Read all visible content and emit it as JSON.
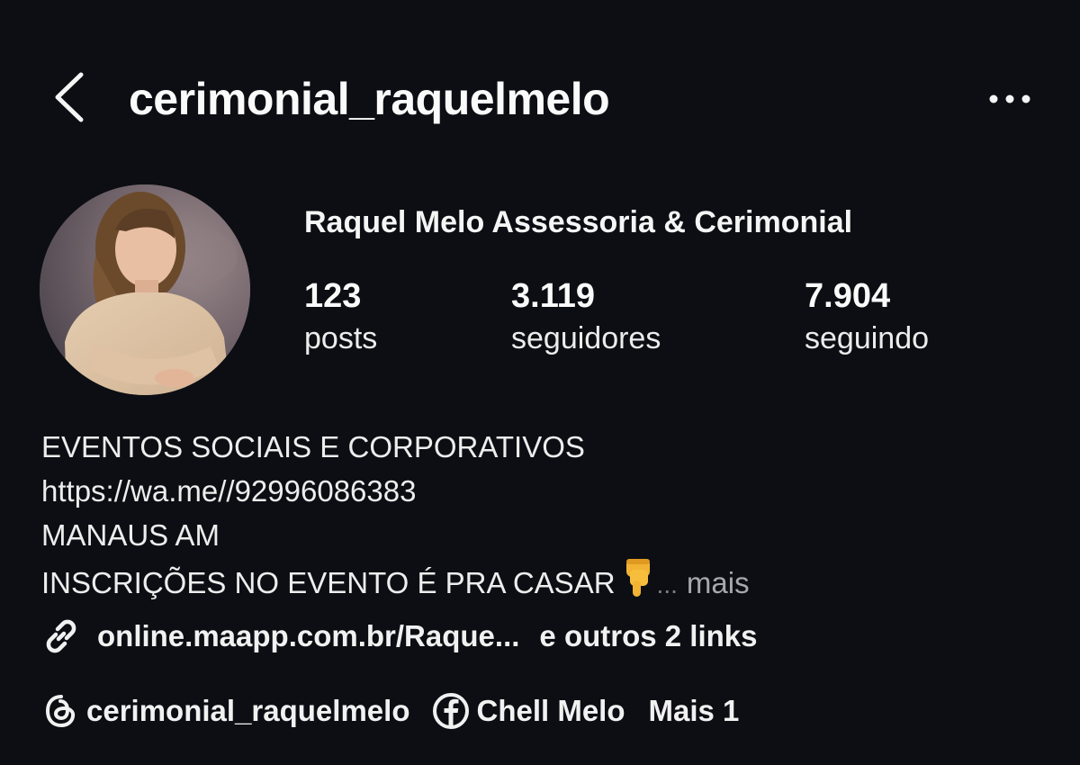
{
  "header": {
    "username": "cerimonial_raquelmelo"
  },
  "profile": {
    "display_name": "Raquel Melo Assessoria & Cerimonial",
    "stats": {
      "posts": {
        "value": "123",
        "label": "posts"
      },
      "followers": {
        "value": "3.119",
        "label": "seguidores"
      },
      "following": {
        "value": "7.904",
        "label": "seguindo"
      }
    },
    "bio": {
      "line1": "EVENTOS SOCIAIS E CORPORATIVOS",
      "line2": "https://wa.me//92996086383",
      "line3": "MANAUS AM",
      "line4": "INSCRIÇÕES NO EVENTO É PRA CASAR",
      "ellipsis": "...",
      "more": "mais"
    },
    "links": {
      "primary": "online.maapp.com.br/Raque...",
      "others": "e outros 2 links"
    },
    "social": {
      "threads": "cerimonial_raquelmelo",
      "facebook": "Chell Melo",
      "more": "Mais 1"
    }
  },
  "icons": {
    "back": "chevron-left-icon",
    "more": "more-horizontal-icon",
    "link": "link-icon",
    "threads": "threads-icon",
    "facebook": "facebook-icon",
    "emoji": "pointing-down-emoji"
  },
  "colors": {
    "background": "#0c0e13",
    "text": "#f5f5f5",
    "muted": "#a6a8ae"
  }
}
